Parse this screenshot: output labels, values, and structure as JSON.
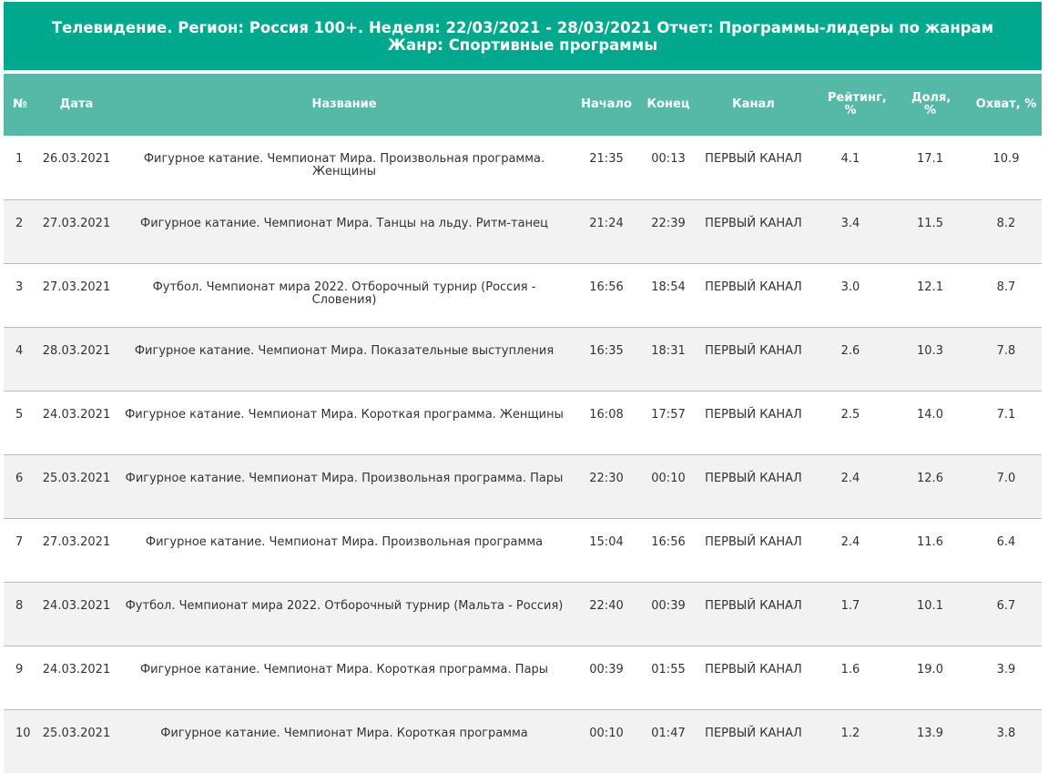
{
  "report": {
    "title": "Телевидение. Регион: Россия 100+. Неделя: 22/03/2021 - 28/03/2021 Отчет: Программы-лидеры по жанрам Жанр: Спортивные программы"
  },
  "table": {
    "headers": {
      "num": "№",
      "date": "Дата",
      "name": "Название",
      "start": "Начало",
      "end": "Конец",
      "channel": "Канал",
      "rating": "Рейтинг, %",
      "share": "Доля, %",
      "reach": "Охват, %"
    },
    "rows": [
      {
        "num": "1",
        "date": "26.03.2021",
        "name": "Фигурное катание. Чемпионат Мира. Произвольная программа. Женщины",
        "start": "21:35",
        "end": "00:13",
        "channel": "ПЕРВЫЙ КАНАЛ",
        "rating": "4.1",
        "share": "17.1",
        "reach": "10.9"
      },
      {
        "num": "2",
        "date": "27.03.2021",
        "name": "Фигурное катание. Чемпионат Мира. Танцы на льду. Ритм-танец",
        "start": "21:24",
        "end": "22:39",
        "channel": "ПЕРВЫЙ КАНАЛ",
        "rating": "3.4",
        "share": "11.5",
        "reach": "8.2"
      },
      {
        "num": "3",
        "date": "27.03.2021",
        "name": "Футбол. Чемпионат мира 2022. Отборочный турнир (Россия - Словения)",
        "start": "16:56",
        "end": "18:54",
        "channel": "ПЕРВЫЙ КАНАЛ",
        "rating": "3.0",
        "share": "12.1",
        "reach": "8.7"
      },
      {
        "num": "4",
        "date": "28.03.2021",
        "name": "Фигурное катание. Чемпионат Мира. Показательные выступления",
        "start": "16:35",
        "end": "18:31",
        "channel": "ПЕРВЫЙ КАНАЛ",
        "rating": "2.6",
        "share": "10.3",
        "reach": "7.8"
      },
      {
        "num": "5",
        "date": "24.03.2021",
        "name": "Фигурное катание. Чемпионат Мира. Короткая программа. Женщины",
        "start": "16:08",
        "end": "17:57",
        "channel": "ПЕРВЫЙ КАНАЛ",
        "rating": "2.5",
        "share": "14.0",
        "reach": "7.1"
      },
      {
        "num": "6",
        "date": "25.03.2021",
        "name": "Фигурное катание. Чемпионат Мира. Произвольная программа. Пары",
        "start": "22:30",
        "end": "00:10",
        "channel": "ПЕРВЫЙ КАНАЛ",
        "rating": "2.4",
        "share": "12.6",
        "reach": "7.0"
      },
      {
        "num": "7",
        "date": "27.03.2021",
        "name": "Фигурное катание. Чемпионат Мира. Произвольная программа",
        "start": "15:04",
        "end": "16:56",
        "channel": "ПЕРВЫЙ КАНАЛ",
        "rating": "2.4",
        "share": "11.6",
        "reach": "6.4"
      },
      {
        "num": "8",
        "date": "24.03.2021",
        "name": "Футбол. Чемпионат мира 2022. Отборочный турнир (Мальта - Россия)",
        "start": "22:40",
        "end": "00:39",
        "channel": "ПЕРВЫЙ КАНАЛ",
        "rating": "1.7",
        "share": "10.1",
        "reach": "6.7"
      },
      {
        "num": "9",
        "date": "24.03.2021",
        "name": "Фигурное катание. Чемпионат Мира. Короткая программа. Пары",
        "start": "00:39",
        "end": "01:55",
        "channel": "ПЕРВЫЙ КАНАЛ",
        "rating": "1.6",
        "share": "19.0",
        "reach": "3.9"
      },
      {
        "num": "10",
        "date": "25.03.2021",
        "name": "Фигурное катание. Чемпионат Мира. Короткая программа",
        "start": "00:10",
        "end": "01:47",
        "channel": "ПЕРВЫЙ КАНАЛ",
        "rating": "1.2",
        "share": "13.9",
        "reach": "3.8"
      }
    ]
  }
}
